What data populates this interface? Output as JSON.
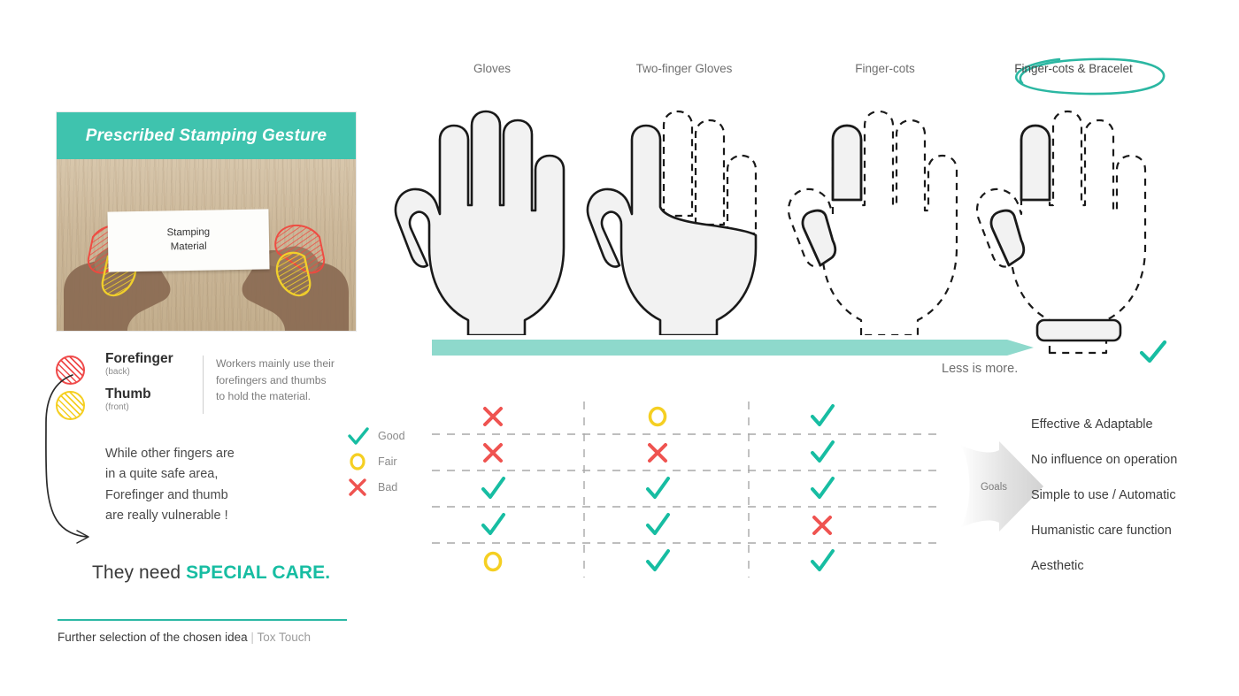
{
  "footer": {
    "title": "Further selection of the chosen idea",
    "separator": "|",
    "brand": "Tox Touch"
  },
  "photo_card": {
    "header_title": "Prescribed Stamping Gesture",
    "stamp_label_line1": "Stamping",
    "stamp_label_line2": "Material"
  },
  "finger_legend": {
    "items": [
      {
        "name": "Forefinger",
        "sub": "(back)",
        "color": "#ef4a4a",
        "swatch": "red"
      },
      {
        "name": "Thumb",
        "sub": "(front)",
        "color": "#f5cf22",
        "swatch": "yellow"
      }
    ],
    "note_line1": "Workers mainly use their",
    "note_line2": "forefingers and thumbs",
    "note_line3": "to hold the material."
  },
  "vulnerable_text": {
    "line1": "While other fingers are",
    "line2": "in a quite safe area,",
    "line3": "Forefinger and thumb",
    "line4": "are really vulnerable !"
  },
  "special_care": {
    "prefix": "They need ",
    "highlight": "SPECIAL CARE.",
    "highlight_color": "#17bda2"
  },
  "columns": [
    {
      "label": "Gloves",
      "highlighted": false
    },
    {
      "label": "Two-finger Gloves",
      "highlighted": false
    },
    {
      "label": "Finger-cots",
      "highlighted": false
    },
    {
      "label": "Finger-cots & Bracelet",
      "highlighted": true
    }
  ],
  "progress_arrow": {
    "caption": "Less is more.",
    "color": "#8ed9cc"
  },
  "chosen_check": "check",
  "rating_legend": [
    {
      "icon": "check",
      "label": "Good",
      "color": "#17bda2"
    },
    {
      "icon": "circle",
      "label": "Fair",
      "color": "#f5cf22"
    },
    {
      "icon": "cross",
      "label": "Bad",
      "color": "#ef5350"
    }
  ],
  "matrix": {
    "column_labels": [
      "Gloves",
      "Two-finger Gloves",
      "Finger-cots"
    ],
    "row_labels": [
      "Effective & Adaptable",
      "No influence on operation",
      "Simple to use / Automatic",
      "Humanistic care function",
      "Aesthetic"
    ],
    "rows": [
      [
        "bad",
        "fair",
        "good"
      ],
      [
        "bad",
        "bad",
        "good"
      ],
      [
        "good",
        "good",
        "good"
      ],
      [
        "good",
        "good",
        "bad"
      ],
      [
        "fair",
        "good",
        "good"
      ]
    ]
  },
  "goals": {
    "arrow_label": "Goals",
    "items": [
      "Effective & Adaptable",
      "No influence on operation",
      "Simple to use / Automatic",
      "Humanistic care function",
      "Aesthetic"
    ]
  },
  "palette": {
    "teal": "#3fc3ae",
    "teal_dark": "#17bda2",
    "teal_light": "#8ed9cc",
    "red": "#ef5350",
    "yellow": "#f5cf22",
    "grid": "#a9a9a9"
  }
}
